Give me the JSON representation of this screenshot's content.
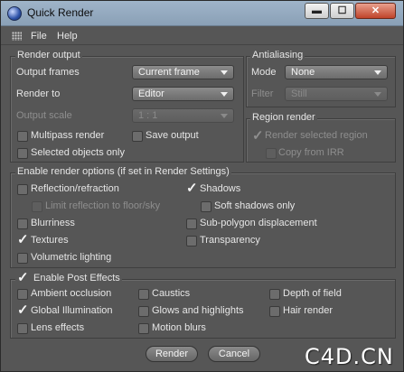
{
  "window": {
    "title": "Quick Render"
  },
  "window_controls": {
    "minimize": "▬",
    "maximize": "☐",
    "close": "✕"
  },
  "menu": {
    "file": "File",
    "help": "Help"
  },
  "render_output": {
    "legend": "Render output",
    "output_frames_label": "Output frames",
    "output_frames_value": "Current frame",
    "render_to_label": "Render to",
    "render_to_value": "Editor",
    "output_scale_label": "Output scale",
    "output_scale_value": "1 : 1",
    "multipass_label": "Multipass render",
    "save_output_label": "Save output",
    "selected_objects_label": "Selected objects only"
  },
  "antialiasing": {
    "legend": "Antialiasing",
    "mode_label": "Mode",
    "mode_value": "None",
    "filter_label": "Filter",
    "filter_value": "Still"
  },
  "region_render": {
    "legend": "Region render",
    "render_selected_label": "Render selected region",
    "copy_irr_label": "Copy from IRR"
  },
  "render_options": {
    "legend": "Enable render options (if set in Render Settings)",
    "reflection": "Reflection/refraction",
    "limit_reflection": "Limit reflection to floor/sky",
    "blurriness": "Blurriness",
    "textures": "Textures",
    "volumetric": "Volumetric lighting",
    "shadows": "Shadows",
    "soft_shadows": "Soft shadows only",
    "subpolygon": "Sub-polygon displacement",
    "transparency": "Transparency"
  },
  "post_effects": {
    "legend": "Enable Post Effects",
    "ambient_occlusion": "Ambient occlusion",
    "global_illumination": "Global Illumination",
    "lens_effects": "Lens effects",
    "caustics": "Caustics",
    "glows": "Glows and highlights",
    "motion_blurs": "Motion blurs",
    "depth_of_field": "Depth of field",
    "hair_render": "Hair render"
  },
  "buttons": {
    "render": "Render",
    "cancel": "Cancel"
  },
  "checkmark": "✓",
  "watermark": "C4D.CN"
}
